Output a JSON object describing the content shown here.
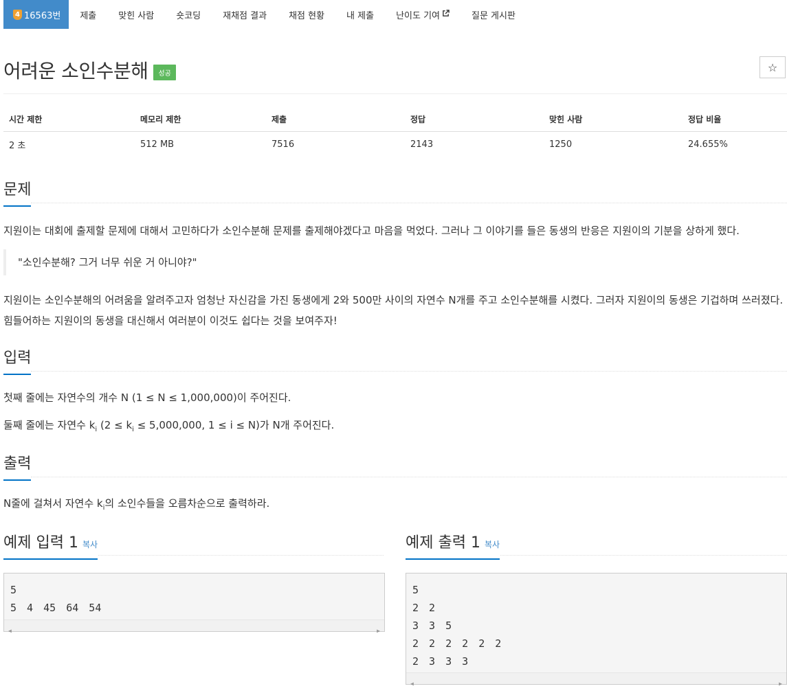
{
  "nav": {
    "tier": "4",
    "problem_id": "16563번",
    "items": [
      "제출",
      "맞힌 사람",
      "숏코딩",
      "재채점 결과",
      "채점 현황",
      "내 제출",
      "난이도 기여",
      "질문 게시판"
    ]
  },
  "problem": {
    "title": "어려운 소인수분해",
    "status": "성공",
    "star": "☆"
  },
  "info": {
    "headers": [
      "시간 제한",
      "메모리 제한",
      "제출",
      "정답",
      "맞힌 사람",
      "정답 비율"
    ],
    "values": [
      "2 초",
      "512 MB",
      "7516",
      "2143",
      "1250",
      "24.655%"
    ]
  },
  "sections": {
    "problem": "문제",
    "input": "입력",
    "output": "출력"
  },
  "description": {
    "p1": "지원이는 대회에 출제할 문제에 대해서 고민하다가 소인수분해 문제를 출제해야겠다고 마음을 먹었다. 그러나 그 이야기를 들은 동생의 반응은 지원이의 기분을 상하게 했다.",
    "quote": "\"소인수분해? 그거 너무 쉬운 거 아니야?\"",
    "p2": "지원이는 소인수분해의 어려움을 알려주고자 엄청난 자신감을 가진 동생에게 2와 500만 사이의 자연수 N개를 주고 소인수분해를 시켰다. 그러자 지원이의 동생은 기겁하며 쓰러졌다. 힘들어하는 지원이의 동생을 대신해서 여러분이 이것도 쉽다는 것을 보여주자!"
  },
  "input_desc": {
    "line1": "첫째 줄에는 자연수의 개수 N (1 ≤ N ≤ 1,000,000)이 주어진다.",
    "line2_a": "둘째 줄에는 자연수 k",
    "line2_sub1": "i",
    "line2_b": " (2 ≤ k",
    "line2_sub2": "i",
    "line2_c": " ≤ 5,000,000, 1 ≤ i ≤ N)가 N개 주어진다."
  },
  "output_desc": {
    "a": "N줄에 걸쳐서 자연수 k",
    "sub": "i",
    "b": "의 소인수들을 오름차순으로 출력하라."
  },
  "samples": {
    "input_title": "예제 입력 1",
    "output_title": "예제 출력 1",
    "copy_label": "복사",
    "input_lines": [
      "5",
      "5 4 45 64 54"
    ],
    "output_lines": [
      "5",
      "2 2",
      "3 3 5",
      "2 2 2 2 2 2",
      "2 3 3 3"
    ]
  }
}
